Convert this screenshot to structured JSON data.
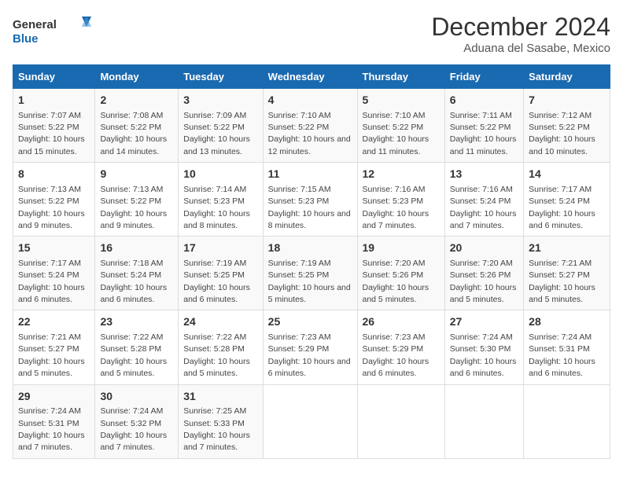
{
  "logo": {
    "line1": "General",
    "line2": "Blue"
  },
  "title": "December 2024",
  "subtitle": "Aduana del Sasabe, Mexico",
  "days_of_week": [
    "Sunday",
    "Monday",
    "Tuesday",
    "Wednesday",
    "Thursday",
    "Friday",
    "Saturday"
  ],
  "weeks": [
    [
      {
        "day": "1",
        "sunrise": "7:07 AM",
        "sunset": "5:22 PM",
        "daylight": "10 hours and 15 minutes."
      },
      {
        "day": "2",
        "sunrise": "7:08 AM",
        "sunset": "5:22 PM",
        "daylight": "10 hours and 14 minutes."
      },
      {
        "day": "3",
        "sunrise": "7:09 AM",
        "sunset": "5:22 PM",
        "daylight": "10 hours and 13 minutes."
      },
      {
        "day": "4",
        "sunrise": "7:10 AM",
        "sunset": "5:22 PM",
        "daylight": "10 hours and 12 minutes."
      },
      {
        "day": "5",
        "sunrise": "7:10 AM",
        "sunset": "5:22 PM",
        "daylight": "10 hours and 11 minutes."
      },
      {
        "day": "6",
        "sunrise": "7:11 AM",
        "sunset": "5:22 PM",
        "daylight": "10 hours and 11 minutes."
      },
      {
        "day": "7",
        "sunrise": "7:12 AM",
        "sunset": "5:22 PM",
        "daylight": "10 hours and 10 minutes."
      }
    ],
    [
      {
        "day": "8",
        "sunrise": "7:13 AM",
        "sunset": "5:22 PM",
        "daylight": "10 hours and 9 minutes."
      },
      {
        "day": "9",
        "sunrise": "7:13 AM",
        "sunset": "5:22 PM",
        "daylight": "10 hours and 9 minutes."
      },
      {
        "day": "10",
        "sunrise": "7:14 AM",
        "sunset": "5:23 PM",
        "daylight": "10 hours and 8 minutes."
      },
      {
        "day": "11",
        "sunrise": "7:15 AM",
        "sunset": "5:23 PM",
        "daylight": "10 hours and 8 minutes."
      },
      {
        "day": "12",
        "sunrise": "7:16 AM",
        "sunset": "5:23 PM",
        "daylight": "10 hours and 7 minutes."
      },
      {
        "day": "13",
        "sunrise": "7:16 AM",
        "sunset": "5:24 PM",
        "daylight": "10 hours and 7 minutes."
      },
      {
        "day": "14",
        "sunrise": "7:17 AM",
        "sunset": "5:24 PM",
        "daylight": "10 hours and 6 minutes."
      }
    ],
    [
      {
        "day": "15",
        "sunrise": "7:17 AM",
        "sunset": "5:24 PM",
        "daylight": "10 hours and 6 minutes."
      },
      {
        "day": "16",
        "sunrise": "7:18 AM",
        "sunset": "5:24 PM",
        "daylight": "10 hours and 6 minutes."
      },
      {
        "day": "17",
        "sunrise": "7:19 AM",
        "sunset": "5:25 PM",
        "daylight": "10 hours and 6 minutes."
      },
      {
        "day": "18",
        "sunrise": "7:19 AM",
        "sunset": "5:25 PM",
        "daylight": "10 hours and 5 minutes."
      },
      {
        "day": "19",
        "sunrise": "7:20 AM",
        "sunset": "5:26 PM",
        "daylight": "10 hours and 5 minutes."
      },
      {
        "day": "20",
        "sunrise": "7:20 AM",
        "sunset": "5:26 PM",
        "daylight": "10 hours and 5 minutes."
      },
      {
        "day": "21",
        "sunrise": "7:21 AM",
        "sunset": "5:27 PM",
        "daylight": "10 hours and 5 minutes."
      }
    ],
    [
      {
        "day": "22",
        "sunrise": "7:21 AM",
        "sunset": "5:27 PM",
        "daylight": "10 hours and 5 minutes."
      },
      {
        "day": "23",
        "sunrise": "7:22 AM",
        "sunset": "5:28 PM",
        "daylight": "10 hours and 5 minutes."
      },
      {
        "day": "24",
        "sunrise": "7:22 AM",
        "sunset": "5:28 PM",
        "daylight": "10 hours and 5 minutes."
      },
      {
        "day": "25",
        "sunrise": "7:23 AM",
        "sunset": "5:29 PM",
        "daylight": "10 hours and 6 minutes."
      },
      {
        "day": "26",
        "sunrise": "7:23 AM",
        "sunset": "5:29 PM",
        "daylight": "10 hours and 6 minutes."
      },
      {
        "day": "27",
        "sunrise": "7:24 AM",
        "sunset": "5:30 PM",
        "daylight": "10 hours and 6 minutes."
      },
      {
        "day": "28",
        "sunrise": "7:24 AM",
        "sunset": "5:31 PM",
        "daylight": "10 hours and 6 minutes."
      }
    ],
    [
      {
        "day": "29",
        "sunrise": "7:24 AM",
        "sunset": "5:31 PM",
        "daylight": "10 hours and 7 minutes."
      },
      {
        "day": "30",
        "sunrise": "7:24 AM",
        "sunset": "5:32 PM",
        "daylight": "10 hours and 7 minutes."
      },
      {
        "day": "31",
        "sunrise": "7:25 AM",
        "sunset": "5:33 PM",
        "daylight": "10 hours and 7 minutes."
      },
      null,
      null,
      null,
      null
    ]
  ]
}
